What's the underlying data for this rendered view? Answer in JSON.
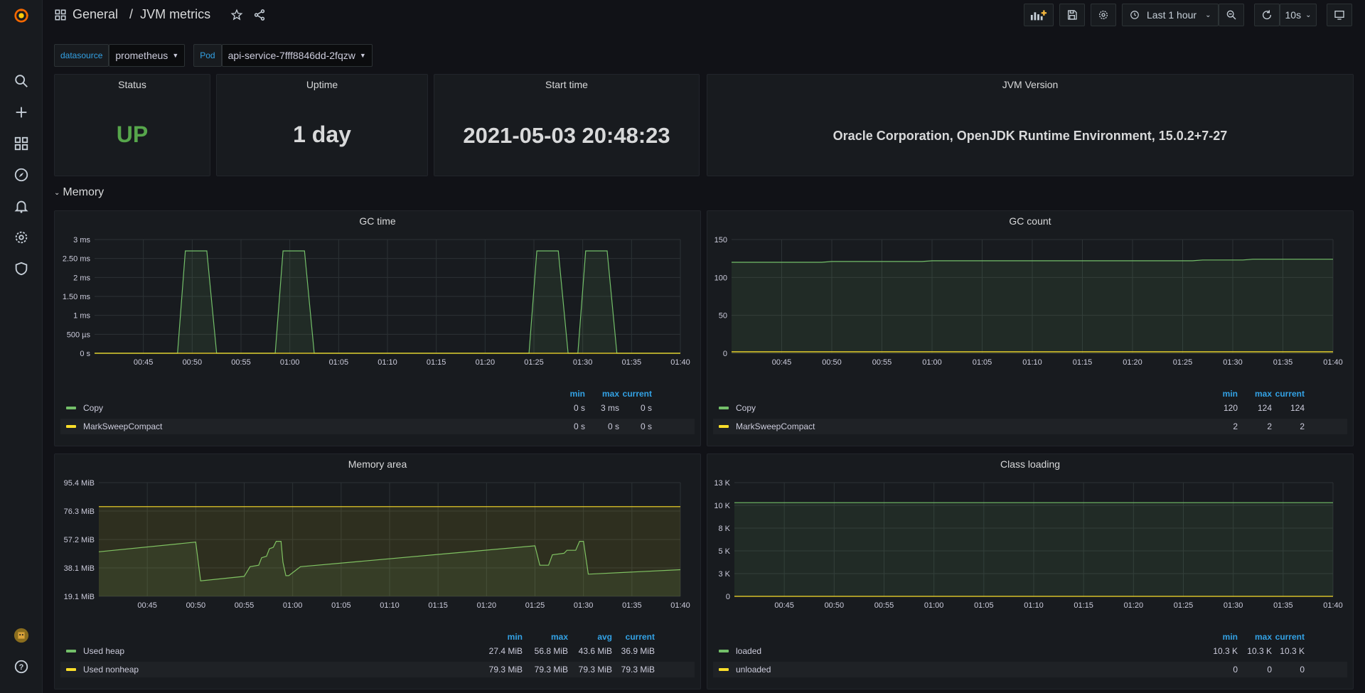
{
  "breadcrumb": {
    "folder": "General",
    "separator": "/",
    "dashboard": "JVM metrics"
  },
  "toolbar": {
    "time_range": "Last 1 hour",
    "refresh": "10s"
  },
  "variables": [
    {
      "label": "datasource",
      "value": "prometheus"
    },
    {
      "label": "Pod",
      "value": "api-service-7fff8846dd-2fqzw"
    }
  ],
  "stats": {
    "status": {
      "title": "Status",
      "value": "UP"
    },
    "uptime": {
      "title": "Uptime",
      "value": "1 day"
    },
    "start_time": {
      "title": "Start time",
      "value": "2021-05-03 20:48:23"
    },
    "jvm_version": {
      "title": "JVM Version",
      "value": "Oracle Corporation, OpenJDK Runtime Environment, 15.0.2+7-27"
    }
  },
  "row": {
    "title": "Memory"
  },
  "colors": {
    "green": "#73bf69",
    "yellow": "#fade2a",
    "status_up": "#56a64b",
    "accent": "#33a2e5"
  },
  "x_ticks": [
    "00:45",
    "00:50",
    "00:55",
    "01:00",
    "01:05",
    "01:10",
    "01:15",
    "01:20",
    "01:25",
    "01:30",
    "01:35",
    "01:40"
  ],
  "chart_data": [
    {
      "type": "area",
      "title": "GC time",
      "y_ticks": [
        "3 ms",
        "2.50 ms",
        "2 ms",
        "1.50 ms",
        "1 ms",
        "500 µs",
        "0 s"
      ],
      "ylim": [
        0,
        3
      ],
      "series": [
        {
          "name": "Copy",
          "color": "#73bf69",
          "x": [
            0,
            8.5,
            9.3,
            11.5,
            12.5,
            18.5,
            19.3,
            21.5,
            22.5,
            44.5,
            45.3,
            47.5,
            48.5,
            49.5,
            50.3,
            52.5,
            53.5,
            60
          ],
          "values": [
            0,
            0,
            2.7,
            2.7,
            0,
            0,
            2.7,
            2.7,
            0,
            0,
            2.7,
            2.7,
            0,
            0,
            2.7,
            2.7,
            0,
            0
          ]
        },
        {
          "name": "MarkSweepCompact",
          "color": "#fade2a",
          "x": [
            0,
            60
          ],
          "values": [
            0,
            0
          ]
        }
      ],
      "legend": {
        "headers": [
          "min",
          "max",
          "current"
        ],
        "rows": [
          [
            "Copy",
            "0 s",
            "3 ms",
            "0 s"
          ],
          [
            "MarkSweepCompact",
            "0 s",
            "0 s",
            "0 s"
          ]
        ]
      }
    },
    {
      "type": "area",
      "title": "GC count",
      "y_ticks": [
        "150",
        "100",
        "50",
        "0"
      ],
      "ylim": [
        0,
        150
      ],
      "series": [
        {
          "name": "Copy",
          "color": "#73bf69",
          "x": [
            0,
            9,
            10,
            19,
            20,
            46,
            47,
            51,
            52,
            60
          ],
          "values": [
            120,
            120,
            121,
            121,
            122,
            122,
            123,
            123,
            124,
            124
          ]
        },
        {
          "name": "MarkSweepCompact",
          "color": "#fade2a",
          "x": [
            0,
            60
          ],
          "values": [
            2,
            2
          ]
        }
      ],
      "legend": {
        "headers": [
          "min",
          "max",
          "current"
        ],
        "rows": [
          [
            "Copy",
            "120",
            "124",
            "124"
          ],
          [
            "MarkSweepCompact",
            "2",
            "2",
            "2"
          ]
        ]
      }
    },
    {
      "type": "area",
      "title": "Memory area",
      "y_ticks": [
        "95.4 MiB",
        "76.3 MiB",
        "57.2 MiB",
        "38.1 MiB",
        "19.1 MiB"
      ],
      "ylim": [
        19.1,
        95.4
      ],
      "series": [
        {
          "name": "Used heap",
          "color": "#73bf69",
          "x": [
            0,
            10,
            10.5,
            15,
            15.6,
            16.5,
            16.8,
            17.3,
            17.6,
            18,
            18.3,
            18.8,
            19,
            19.3,
            19.6,
            20.4,
            20.8,
            45,
            45.5,
            46.4,
            46.8,
            48,
            48.3,
            49.2,
            49.6,
            50,
            50.5,
            60
          ],
          "values": [
            49,
            55.5,
            29.5,
            32.5,
            39,
            40,
            45,
            46,
            51,
            52,
            56,
            56,
            42,
            33,
            33,
            37,
            39,
            53,
            40,
            40,
            47,
            48,
            50,
            50,
            56,
            56,
            34,
            37
          ]
        },
        {
          "name": "Used nonheap",
          "color": "#fade2a",
          "x": [
            0,
            60
          ],
          "values": [
            79.3,
            79.3
          ]
        }
      ],
      "legend": {
        "headers": [
          "min",
          "max",
          "avg",
          "current"
        ],
        "rows": [
          [
            "Used heap",
            "27.4 MiB",
            "56.8 MiB",
            "43.6 MiB",
            "36.9 MiB"
          ],
          [
            "Used nonheap",
            "79.3 MiB",
            "79.3 MiB",
            "79.3 MiB",
            "79.3 MiB"
          ]
        ]
      }
    },
    {
      "type": "area",
      "title": "Class loading",
      "y_ticks": [
        "13 K",
        "10 K",
        "8 K",
        "5 K",
        "3 K",
        "0"
      ],
      "ylim": [
        0,
        12.5
      ],
      "series": [
        {
          "name": "loaded",
          "color": "#73bf69",
          "x": [
            0,
            60
          ],
          "values": [
            10.3,
            10.3
          ]
        },
        {
          "name": "unloaded",
          "color": "#fade2a",
          "x": [
            0,
            60
          ],
          "values": [
            0,
            0
          ]
        }
      ],
      "legend": {
        "headers": [
          "min",
          "max",
          "current"
        ],
        "rows": [
          [
            "loaded",
            "10.3 K",
            "10.3 K",
            "10.3 K"
          ],
          [
            "unloaded",
            "0",
            "0",
            "0"
          ]
        ]
      }
    }
  ]
}
